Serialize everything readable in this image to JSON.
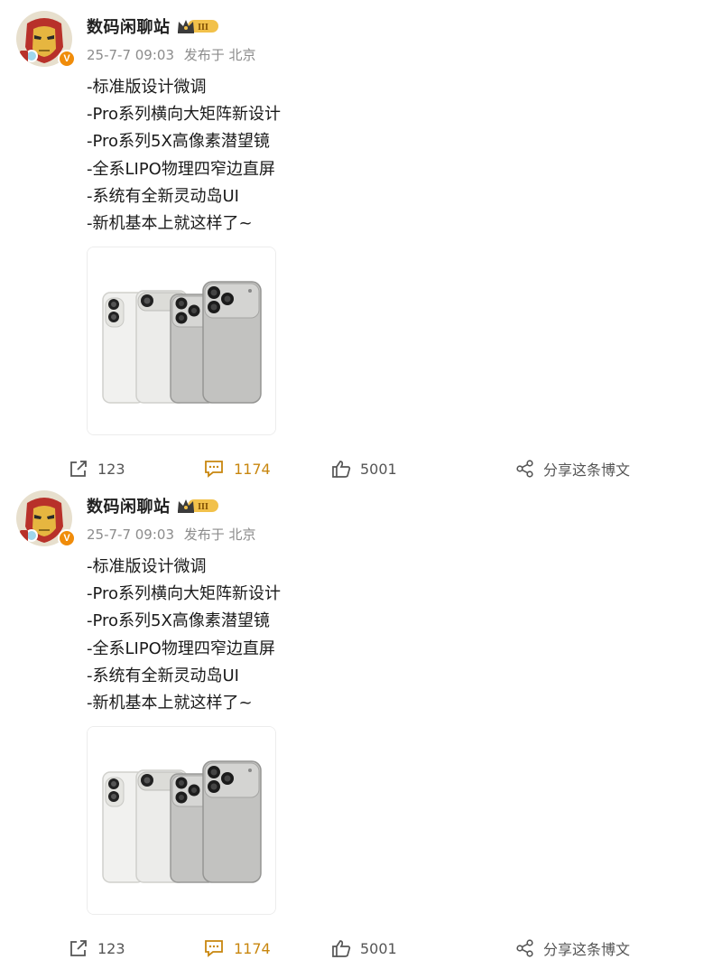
{
  "posts": [
    {
      "author": {
        "name": "数码闲聊站",
        "level_badge": "III",
        "verified_mark": "V"
      },
      "meta": {
        "time": "25-7-7 09:03",
        "source": "发布于 北京"
      },
      "lines": [
        "-标准版设计微调",
        "-Pro系列横向大矩阵新设计",
        "-Pro系列5X高像素潜望镜",
        "-全系LIPO物理四窄边直屏",
        "-系统有全新灵动岛UI",
        "-新机基本上就这样了~"
      ],
      "image": {
        "subject": "phone-lineup-render"
      },
      "actions": {
        "repost_count": "123",
        "comment_count": "1174",
        "like_count": "5001",
        "share_label": "分享这条博文"
      }
    },
    {
      "author": {
        "name": "数码闲聊站",
        "level_badge": "III",
        "verified_mark": "V"
      },
      "meta": {
        "time": "25-7-7 09:03",
        "source": "发布于 北京"
      },
      "lines": [
        "-标准版设计微调",
        "-Pro系列横向大矩阵新设计",
        "-Pro系列5X高像素潜望镜",
        "-全系LIPO物理四窄边直屏",
        "-系统有全新灵动岛UI",
        "-新机基本上就这样了~"
      ],
      "image": {
        "subject": "phone-lineup-render"
      },
      "actions": {
        "repost_count": "123",
        "comment_count": "1174",
        "like_count": "5001",
        "share_label": "分享这条博文"
      }
    }
  ],
  "colors": {
    "accent_gold": "#c8860e",
    "verified_orange": "#f08c0a",
    "muted_text": "#8c8c8c"
  },
  "icons": [
    "repost-icon",
    "comment-icon",
    "like-icon",
    "share-icon",
    "level-crown-icon",
    "verified-icon"
  ]
}
